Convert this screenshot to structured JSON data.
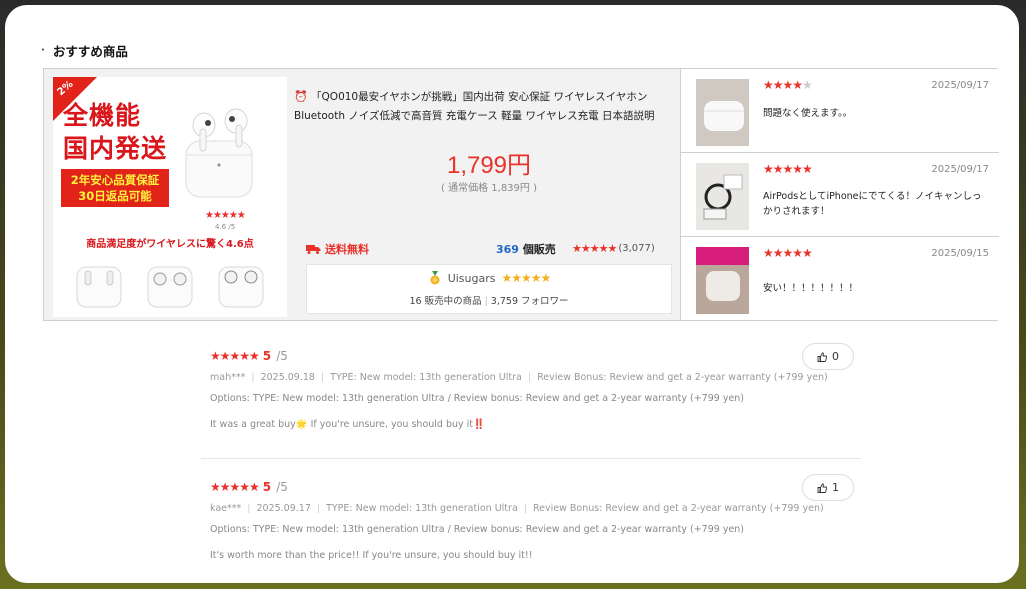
{
  "section": {
    "title": "おすすめ商品",
    "bullet": "·"
  },
  "product": {
    "badge_percent": "2%",
    "promo_lines": [
      "全機能",
      "国内発送"
    ],
    "promo_box_lines": [
      "2年安心品質保証",
      "30日返品可能"
    ],
    "promo_rating": "4.6",
    "promo_rating_max": "/5",
    "promo_stars": "★★★★★",
    "promo2_banner": "商品満足度がワイヤレスに驚く4.6点",
    "title_line1": "「QO010最安イヤホンが挑戦」国内出荷 安心保証 ワイヤレスイヤホン",
    "title_line2": "Bluetooth ノイズ低減で高音質 充電ケース 軽量 ワイヤレス充電 日本語説明",
    "price": "1,799円",
    "original_price": "( 通常価格 1,839円 )",
    "shipping": "送料無料",
    "sold_count": "369",
    "sold_label": "個販売",
    "rating_stars": "★★★★★",
    "rating_count": "(3,077)"
  },
  "shop": {
    "name": "Uisugars",
    "stars": "★★★★★",
    "listing_count": "16",
    "listing_label": "販売中の商品",
    "followers": "3,759",
    "followers_label": "フォロワー"
  },
  "mini_reviews": [
    {
      "stars_on": "★★★★",
      "stars_off": "★",
      "date": "2025/09/17",
      "text": "問題なく使えます。。"
    },
    {
      "stars_on": "★★★★★",
      "stars_off": "",
      "date": "2025/09/17",
      "text": "AirPodsとしてiPhoneにでてくる！ノイキャンしっかりされます！"
    },
    {
      "stars_on": "★★★★★",
      "stars_off": "",
      "date": "2025/09/15",
      "text": "安い！！！！！！！！"
    }
  ],
  "reviews": [
    {
      "stars": "★★★★★",
      "score": "5",
      "max": "/5",
      "user": "mah***",
      "date": "2025.09.18",
      "type": "TYPE: New model: 13th generation Ultra",
      "bonus": "Review Bonus: Review and get a 2-year warranty (+799 yen)",
      "options": "Options: TYPE: New model: 13th generation Ultra / Review bonus: Review and get a 2-year warranty (+799 yen)",
      "body": "It was a great buy🌟 If you're unsure, you should buy it‼️",
      "likes": "0"
    },
    {
      "stars": "★★★★★",
      "score": "5",
      "max": "/5",
      "user": "kae***",
      "date": "2025.09.17",
      "type": "TYPE: New model: 13th generation Ultra",
      "bonus": "Review Bonus: Review and get a 2-year warranty (+799 yen)",
      "options": "Options: TYPE: New model: 13th generation Ultra / Review bonus: Review and get a 2-year warranty (+799 yen)",
      "body": "It's worth more than the price!! If you're unsure, you should buy it!!",
      "likes": "1"
    }
  ],
  "colors": {
    "accent_red": "#e8322a",
    "link_blue": "#2266cc",
    "gold": "#f2b01e"
  }
}
